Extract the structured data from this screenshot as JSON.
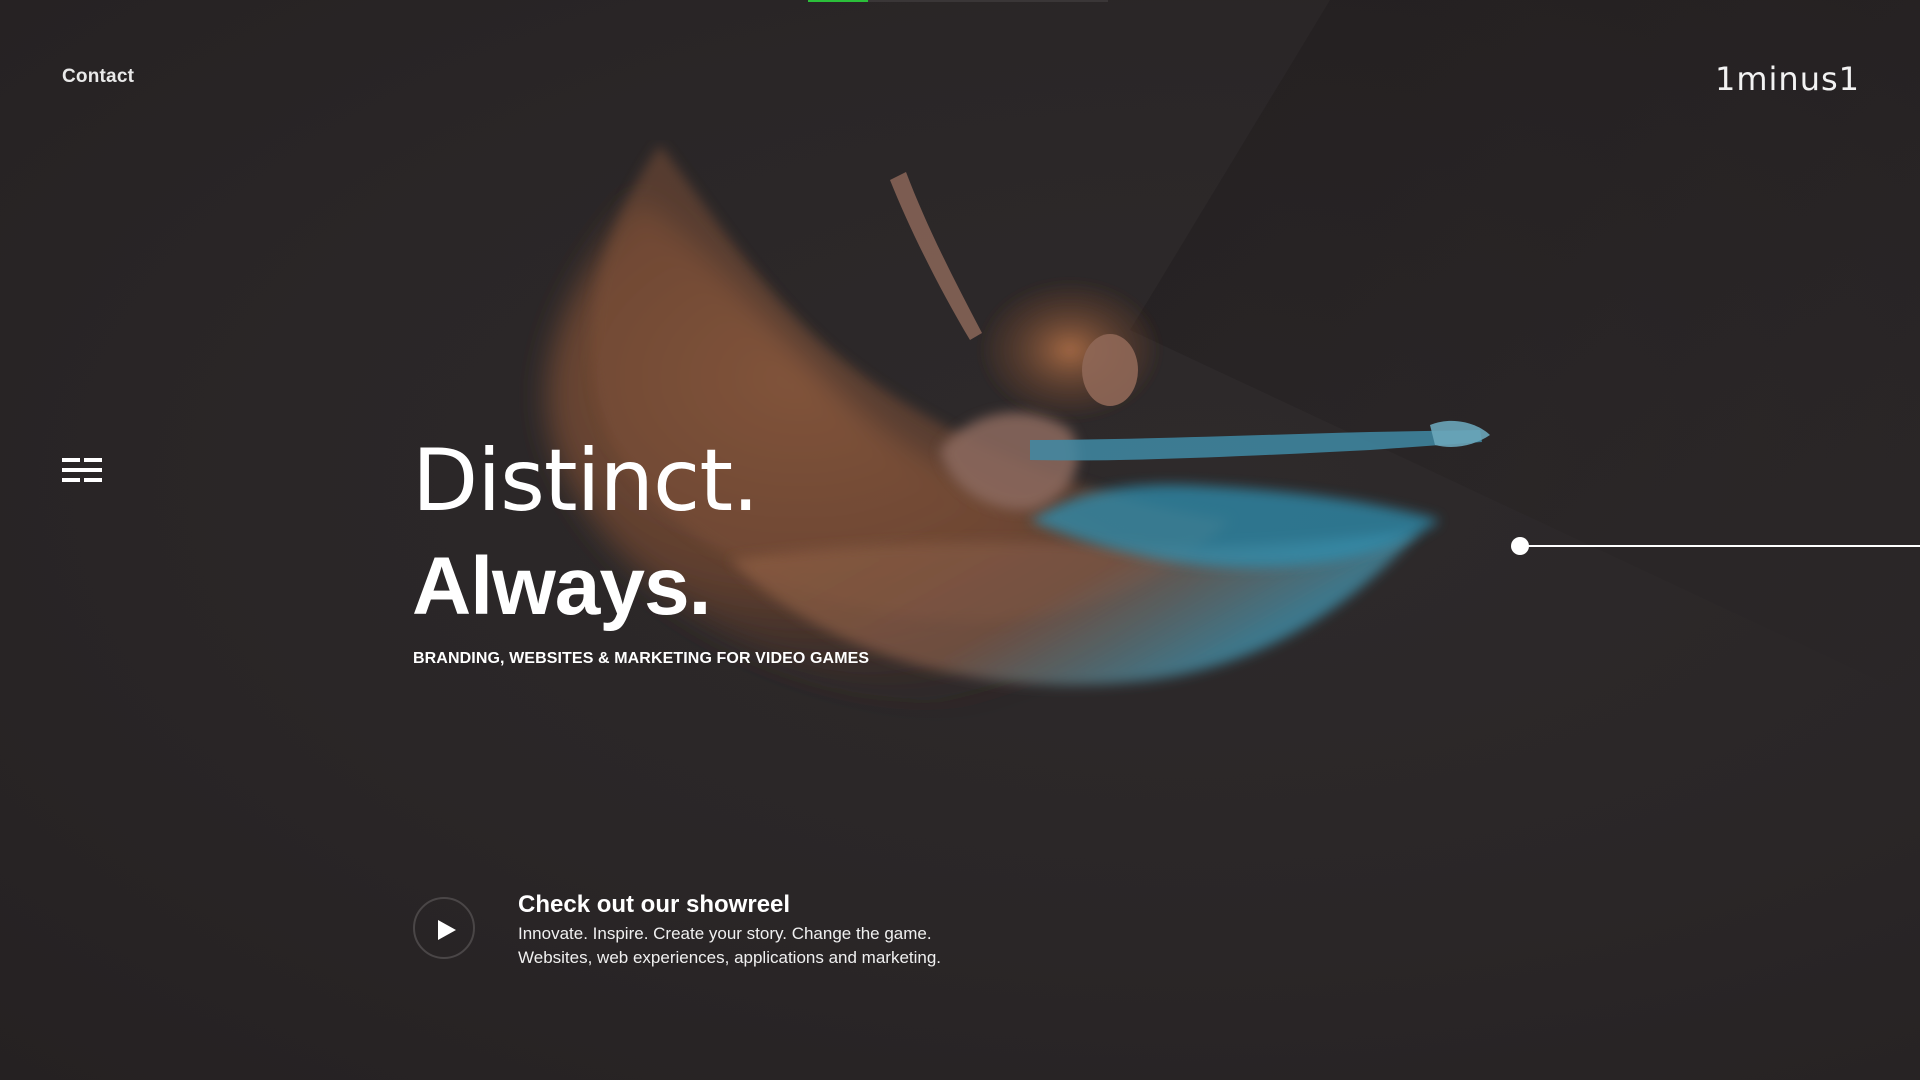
{
  "header": {
    "contact_label": "Contact",
    "logo_text": "1minus1"
  },
  "progress": {
    "value_fraction": 0.2,
    "accent_color": "#2bbf3a"
  },
  "icons": {
    "menu": "hamburger-menu-icon",
    "play": "play-icon"
  },
  "hero": {
    "headline_light": "Distinct.",
    "headline_bold": "Always.",
    "tagline": "BRANDING, WEBSITES & MARKETING FOR VIDEO GAMES"
  },
  "showreel": {
    "title": "Check out our showreel",
    "line1": "Innovate. Inspire. Create your story. Change the game.",
    "line2": "Websites, web experiences, applications and marketing."
  },
  "colors": {
    "background": "#2b2728",
    "dress_warm": "#8a5a3e",
    "dress_cool": "#2f8fb0",
    "text": "#ffffff"
  }
}
